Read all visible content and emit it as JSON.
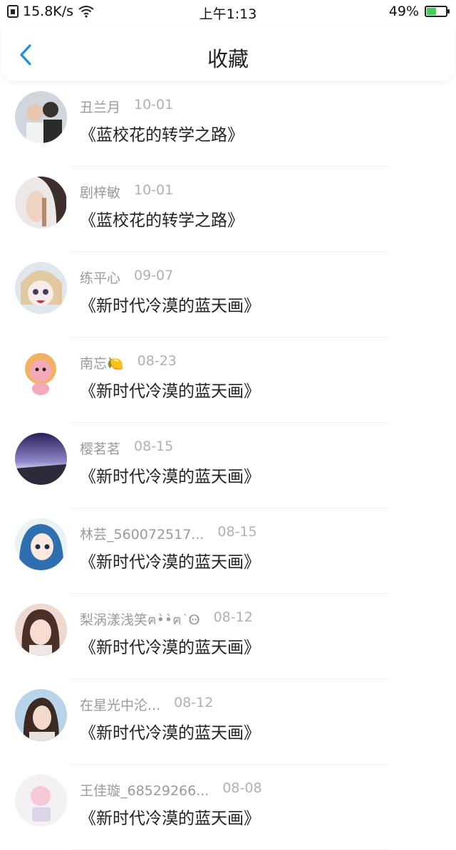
{
  "status_bar": {
    "speed": "15.8K/s",
    "time": "上午1:13",
    "battery_percent": "49%",
    "battery_level": 0.49,
    "accent": "#3bd15c"
  },
  "header": {
    "title": "收藏",
    "back_icon": "chevron-left-icon",
    "accent": "#1a8fe3"
  },
  "items": [
    {
      "name": "丑兰月",
      "date": "10-01",
      "book": "《蓝校花的转学之路》"
    },
    {
      "name": "剧梓敏",
      "date": "10-01",
      "book": "《蓝校花的转学之路》"
    },
    {
      "name": "练平心",
      "date": "09-07",
      "book": "《新时代冷漠的蓝天画》"
    },
    {
      "name": "南忘🍋",
      "date": "08-23",
      "book": "《新时代冷漠的蓝天画》"
    },
    {
      "name": "樱茗茗",
      "date": "08-15",
      "book": "《新时代冷漠的蓝天画》"
    },
    {
      "name": "林芸_560072517...",
      "date": "08-15",
      "book": "《新时代冷漠的蓝天画》"
    },
    {
      "name": "梨涡漾浅笑ฅ•̀•̀ฅ˙Ꙫ",
      "date": "08-12",
      "book": "《新时代冷漠的蓝天画》"
    },
    {
      "name": "在星光中沦...",
      "date": "08-12",
      "book": "《新时代冷漠的蓝天画》"
    },
    {
      "name": "王佳璇_68529266...",
      "date": "08-08",
      "book": "《新时代冷漠的蓝天画》"
    }
  ]
}
